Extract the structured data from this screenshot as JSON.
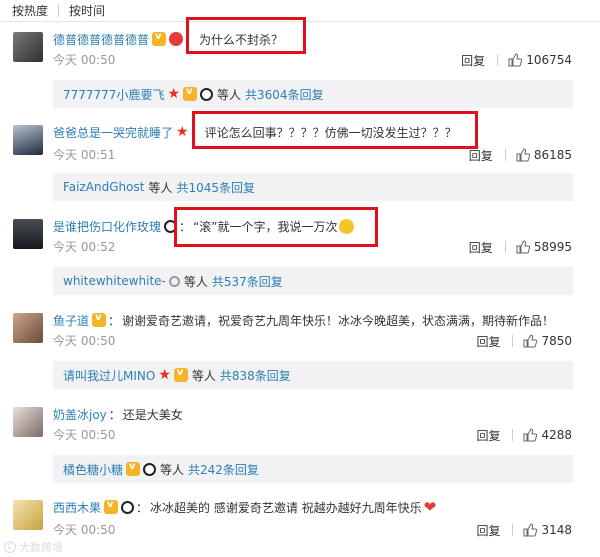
{
  "sort": {
    "hot": "按热度",
    "time": "按时间"
  },
  "reply_label": "回复",
  "comments": [
    {
      "name": "德普德普德普德普",
      "text": "为什么不封杀？",
      "time": "今天 00:50",
      "likes": "106754",
      "reply": {
        "name": "7777777小鹿要飞",
        "others": "等人",
        "count": "共3604条回复"
      }
    },
    {
      "name": "爸爸总是一哭完就睡了",
      "text": "评论怎么回事？？？？仿佛一切没发生过？？？",
      "time": "今天 00:51",
      "likes": "86185",
      "reply": {
        "name": "FaizAndGhost",
        "others": "等人",
        "count": "共1045条回复"
      }
    },
    {
      "name": "是谁把伤口化作玫瑰",
      "text": "“滚”就一个字，我说一万次",
      "time": "今天 00:52",
      "likes": "58995",
      "reply": {
        "name": "whitewhitewhite-",
        "others": "等人",
        "count": "共537条回复"
      }
    },
    {
      "name": "鱼子道",
      "text": "谢谢爱奇艺邀请，祝爱奇艺九周年快乐！冰冰今晚超美，状态满满，期待新作品！",
      "time": "今天 00:50",
      "likes": "7850",
      "reply": {
        "name": "请叫我过儿MINO",
        "others": "等人",
        "count": "共838条回复"
      }
    },
    {
      "name": "奶盖冰joy",
      "text": "还是大美女",
      "time": "今天 00:50",
      "likes": "4288",
      "reply": {
        "name": "橘色糖小糖",
        "others": "等人",
        "count": "共242条回复"
      }
    },
    {
      "name": "西西木果",
      "text": "冰冰超美的   感谢爱奇艺邀请   祝越办越好九周年快乐",
      "time": "今天 00:50",
      "likes": "3148"
    }
  ],
  "watermark": "大数跨境",
  "colors": {
    "username": "#eb7350",
    "link": "#2d7fb2",
    "highlight": "#e0101c",
    "reply_bg": "#f2f2f5"
  }
}
